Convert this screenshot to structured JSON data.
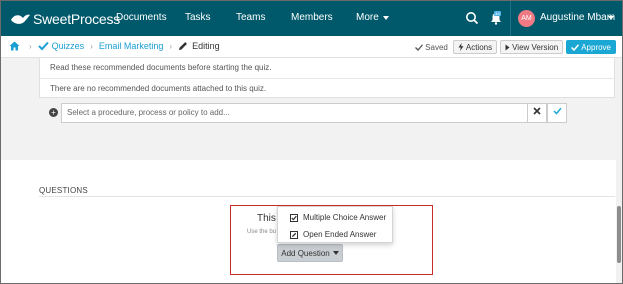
{
  "app": {
    "logo_text": "SweetProcess"
  },
  "nav": {
    "items": [
      "Documents",
      "Tasks",
      "Teams",
      "Members"
    ],
    "more_label": "More",
    "user_initials": "AM",
    "user_name": "Augustine Mbam",
    "notification_badge": "44"
  },
  "breadcrumb": {
    "quizzes": "Quizzes",
    "email_marketing": "Email Marketing",
    "editing": "Editing"
  },
  "toolbar": {
    "saved_label": "Saved",
    "actions_label": "Actions",
    "view_version_label": "View Version",
    "approve_label": "Approve"
  },
  "documents": {
    "intro": "Read these recommended documents before starting the quiz.",
    "empty": "There are no recommended documents attached to this quiz.",
    "select_placeholder": "Select a procedure, process or policy to add..."
  },
  "questions": {
    "heading": "QUESTIONS",
    "partial_title": "This q",
    "partial_hint": "Use the bu",
    "add_button": "Add Question",
    "menu": [
      "Multiple Choice Answer",
      "Open Ended Answer"
    ]
  },
  "colors": {
    "topbar": "#00596b",
    "accent": "#1aa7d4",
    "highlight_box": "#c92b2b"
  }
}
